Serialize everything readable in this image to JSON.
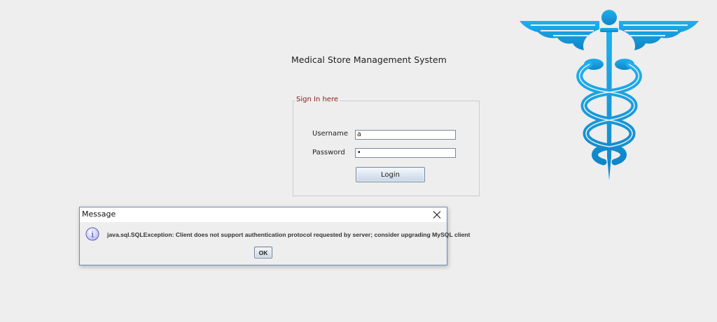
{
  "app": {
    "title": "Medical Store Management System"
  },
  "signin": {
    "legend": "Sign In here",
    "username_label": "Username",
    "username_value": "a",
    "password_label": "Password",
    "password_value": "•",
    "login_label": "Login"
  },
  "logo": {
    "icon": "caduceus-icon",
    "color": "#1aa3e8"
  },
  "dialog": {
    "title": "Message",
    "icon": "info-icon",
    "message": "java.sql.SQLException: Client does not support authentication protocol requested by server; consider upgrading MySQL client",
    "ok_label": "OK"
  }
}
